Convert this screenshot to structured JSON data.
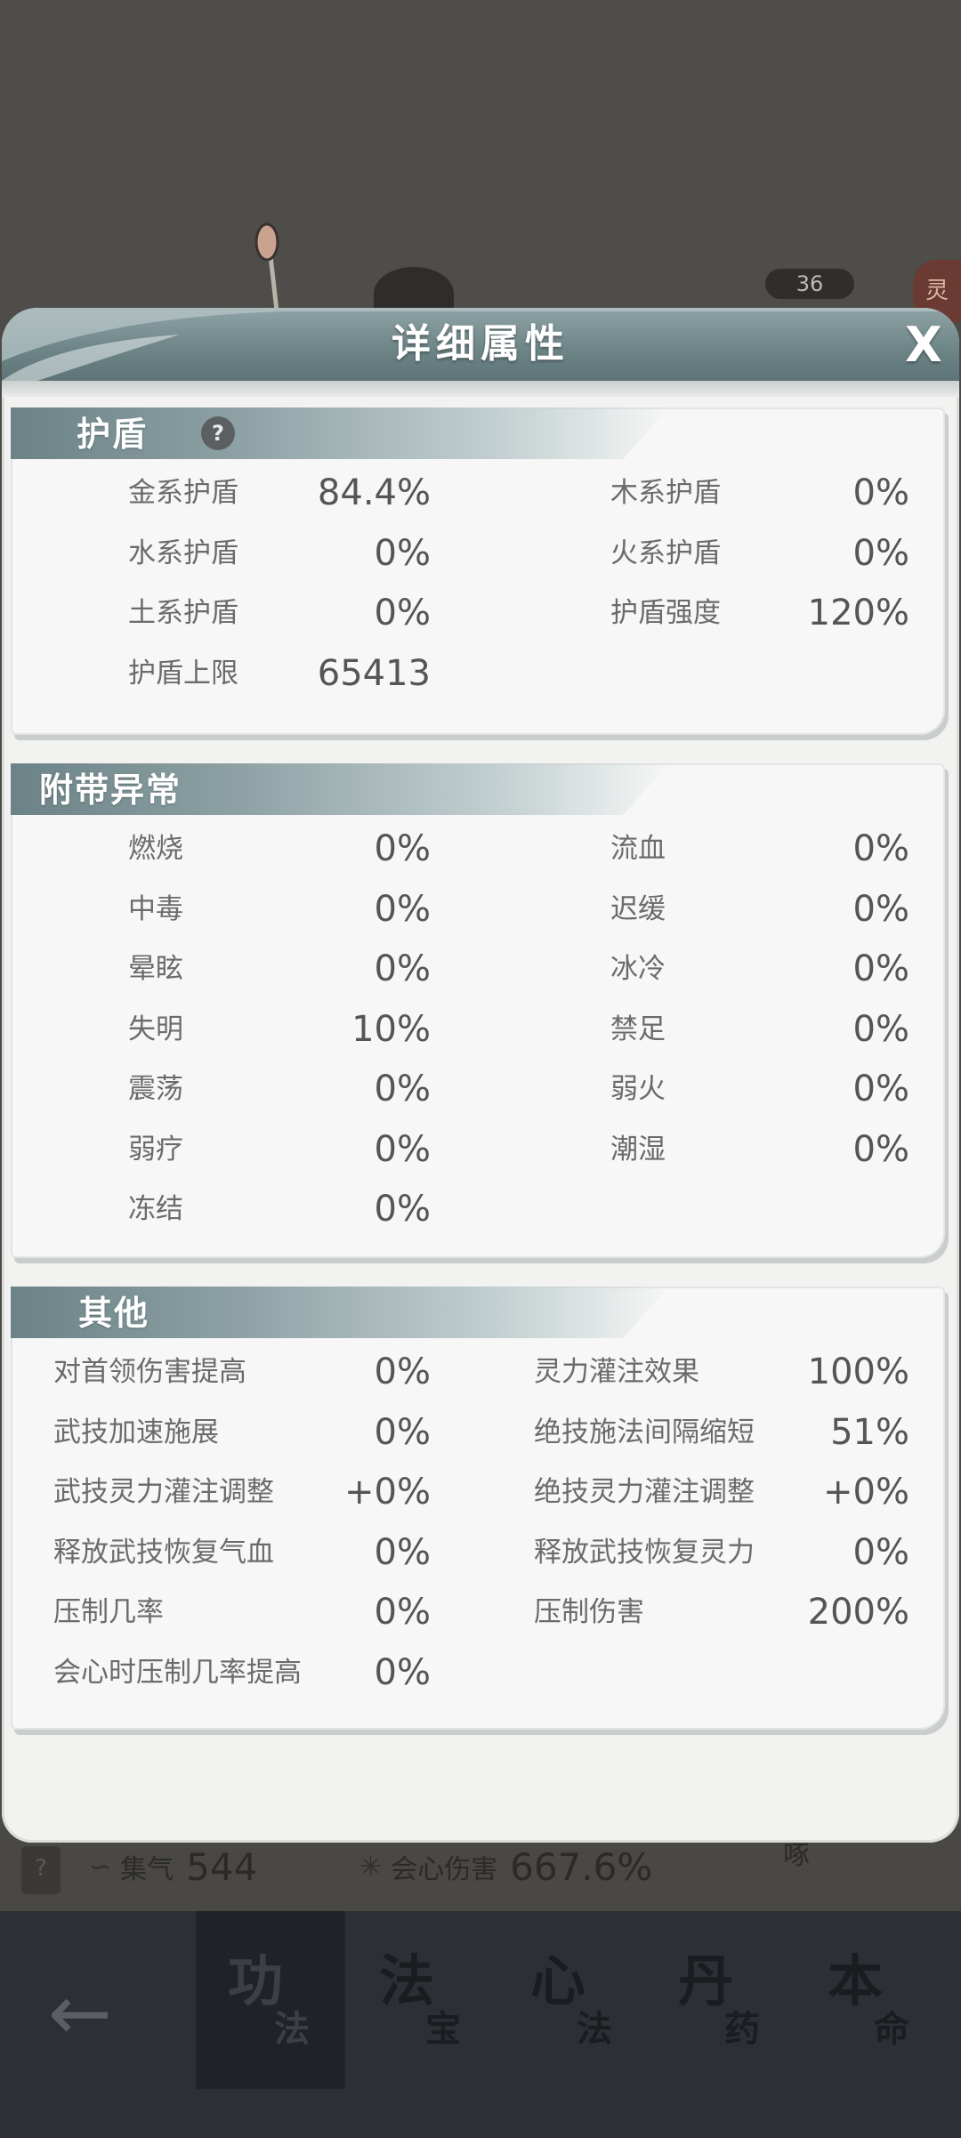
{
  "background": {
    "count_badge": "36",
    "right_badge": "灵",
    "stats": [
      {
        "label": "集气",
        "value": "544"
      },
      {
        "label": "会心伤害",
        "value": "667.6%"
      }
    ],
    "help": "?",
    "corner_text": "啄"
  },
  "modal": {
    "title": "详细属性",
    "close": "X"
  },
  "sections": {
    "shield": {
      "title": "护盾",
      "help": "?",
      "left": [
        {
          "label": "金系护盾",
          "value": "84.4%"
        },
        {
          "label": "水系护盾",
          "value": "0%"
        },
        {
          "label": "土系护盾",
          "value": "0%"
        },
        {
          "label": "护盾上限",
          "value": "65413"
        }
      ],
      "right": [
        {
          "label": "木系护盾",
          "value": "0%"
        },
        {
          "label": "火系护盾",
          "value": "0%"
        },
        {
          "label": "护盾强度",
          "value": "120%"
        }
      ]
    },
    "abnormal": {
      "title": "附带异常",
      "left": [
        {
          "label": "燃烧",
          "value": "0%"
        },
        {
          "label": "中毒",
          "value": "0%"
        },
        {
          "label": "晕眩",
          "value": "0%"
        },
        {
          "label": "失明",
          "value": "10%"
        },
        {
          "label": "震荡",
          "value": "0%"
        },
        {
          "label": "弱疗",
          "value": "0%"
        },
        {
          "label": "冻结",
          "value": "0%"
        }
      ],
      "right": [
        {
          "label": "流血",
          "value": "0%"
        },
        {
          "label": "迟缓",
          "value": "0%"
        },
        {
          "label": "冰冷",
          "value": "0%"
        },
        {
          "label": "禁足",
          "value": "0%"
        },
        {
          "label": "弱火",
          "value": "0%"
        },
        {
          "label": "潮湿",
          "value": "0%"
        }
      ]
    },
    "other": {
      "title": "其他",
      "left": [
        {
          "label": "对首领伤害提高",
          "value": "0%"
        },
        {
          "label": "武技加速施展",
          "value": "0%"
        },
        {
          "label": "武技灵力灌注调整",
          "value": "+0%"
        },
        {
          "label": "释放武技恢复气血",
          "value": "0%"
        },
        {
          "label": "压制几率",
          "value": "0%"
        },
        {
          "label": "会心时压制几率提高",
          "value": "0%"
        }
      ],
      "right": [
        {
          "label": "灵力灌注效果",
          "value": "100%"
        },
        {
          "label": "绝技施法间隔缩短",
          "value": "51%"
        },
        {
          "label": "绝技灵力灌注调整",
          "value": "+0%"
        },
        {
          "label": "释放武技恢复灵力",
          "value": "0%"
        },
        {
          "label": "压制伤害",
          "value": "200%"
        }
      ]
    }
  },
  "bottom_nav": {
    "back": "←",
    "tabs": [
      {
        "big": "功",
        "small": "法"
      },
      {
        "big": "法",
        "small": "宝"
      },
      {
        "big": "心",
        "small": "法"
      },
      {
        "big": "丹",
        "small": "药"
      },
      {
        "big": "本",
        "small": "命"
      }
    ]
  }
}
